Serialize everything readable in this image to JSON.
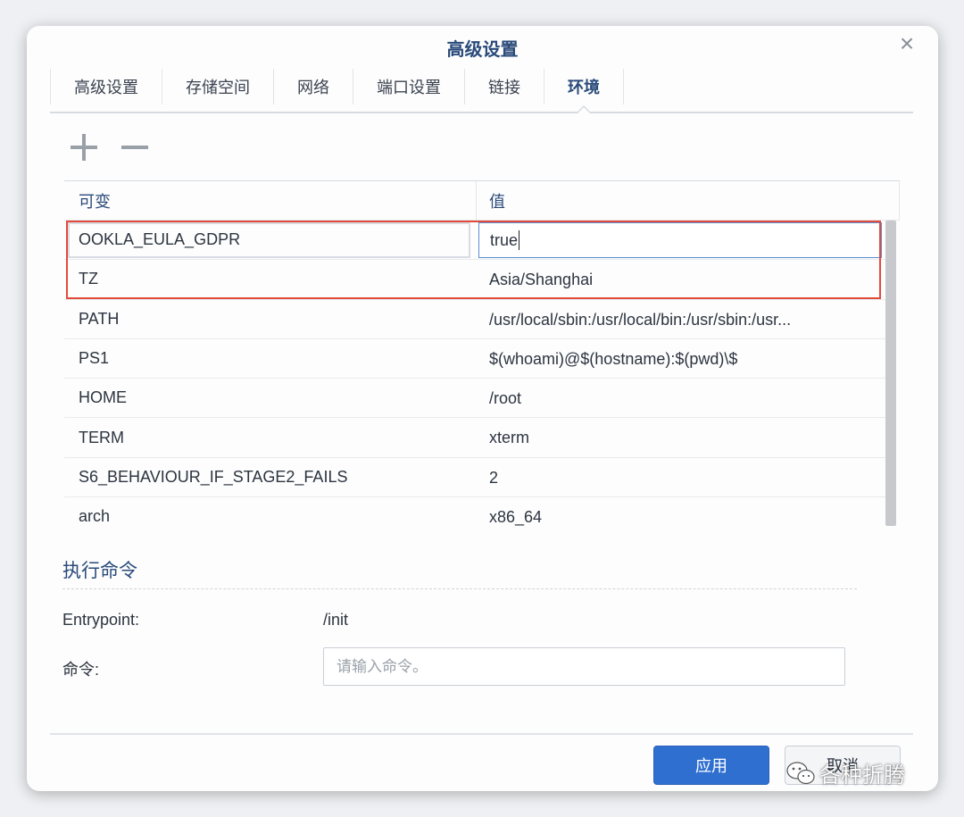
{
  "dialog": {
    "title": "高级设置",
    "close_icon": "close-icon"
  },
  "tabs": [
    {
      "label": "高级设置",
      "active": false
    },
    {
      "label": "存储空间",
      "active": false
    },
    {
      "label": "网络",
      "active": false
    },
    {
      "label": "端口设置",
      "active": false
    },
    {
      "label": "链接",
      "active": false
    },
    {
      "label": "环境",
      "active": true
    }
  ],
  "toolbar": {
    "add_icon": "plus-icon",
    "remove_icon": "minus-icon"
  },
  "env_table": {
    "headers": {
      "name": "可变",
      "value": "值"
    },
    "rows": [
      {
        "name": "OOKLA_EULA_GDPR",
        "value": "true"
      },
      {
        "name": "TZ",
        "value": "Asia/Shanghai"
      },
      {
        "name": "PATH",
        "value": "/usr/local/sbin:/usr/local/bin:/usr/sbin:/usr..."
      },
      {
        "name": "PS1",
        "value": "$(whoami)@$(hostname):$(pwd)\\$"
      },
      {
        "name": "HOME",
        "value": "/root"
      },
      {
        "name": "TERM",
        "value": "xterm"
      },
      {
        "name": "S6_BEHAVIOUR_IF_STAGE2_FAILS",
        "value": "2"
      },
      {
        "name": "arch",
        "value": "x86_64"
      }
    ]
  },
  "exec": {
    "section_title": "执行命令",
    "entrypoint_label": "Entrypoint:",
    "entrypoint_value": "/init",
    "command_label": "命令:",
    "command_placeholder": "请输入命令。",
    "command_value": ""
  },
  "footer": {
    "apply_label": "应用",
    "cancel_label": "取消"
  },
  "watermark": {
    "text": "各种折腾",
    "icon": "wechat-icon"
  },
  "colors": {
    "accent": "#2f6fd0",
    "highlight": "#e24b3b",
    "heading": "#2a4a7a"
  }
}
